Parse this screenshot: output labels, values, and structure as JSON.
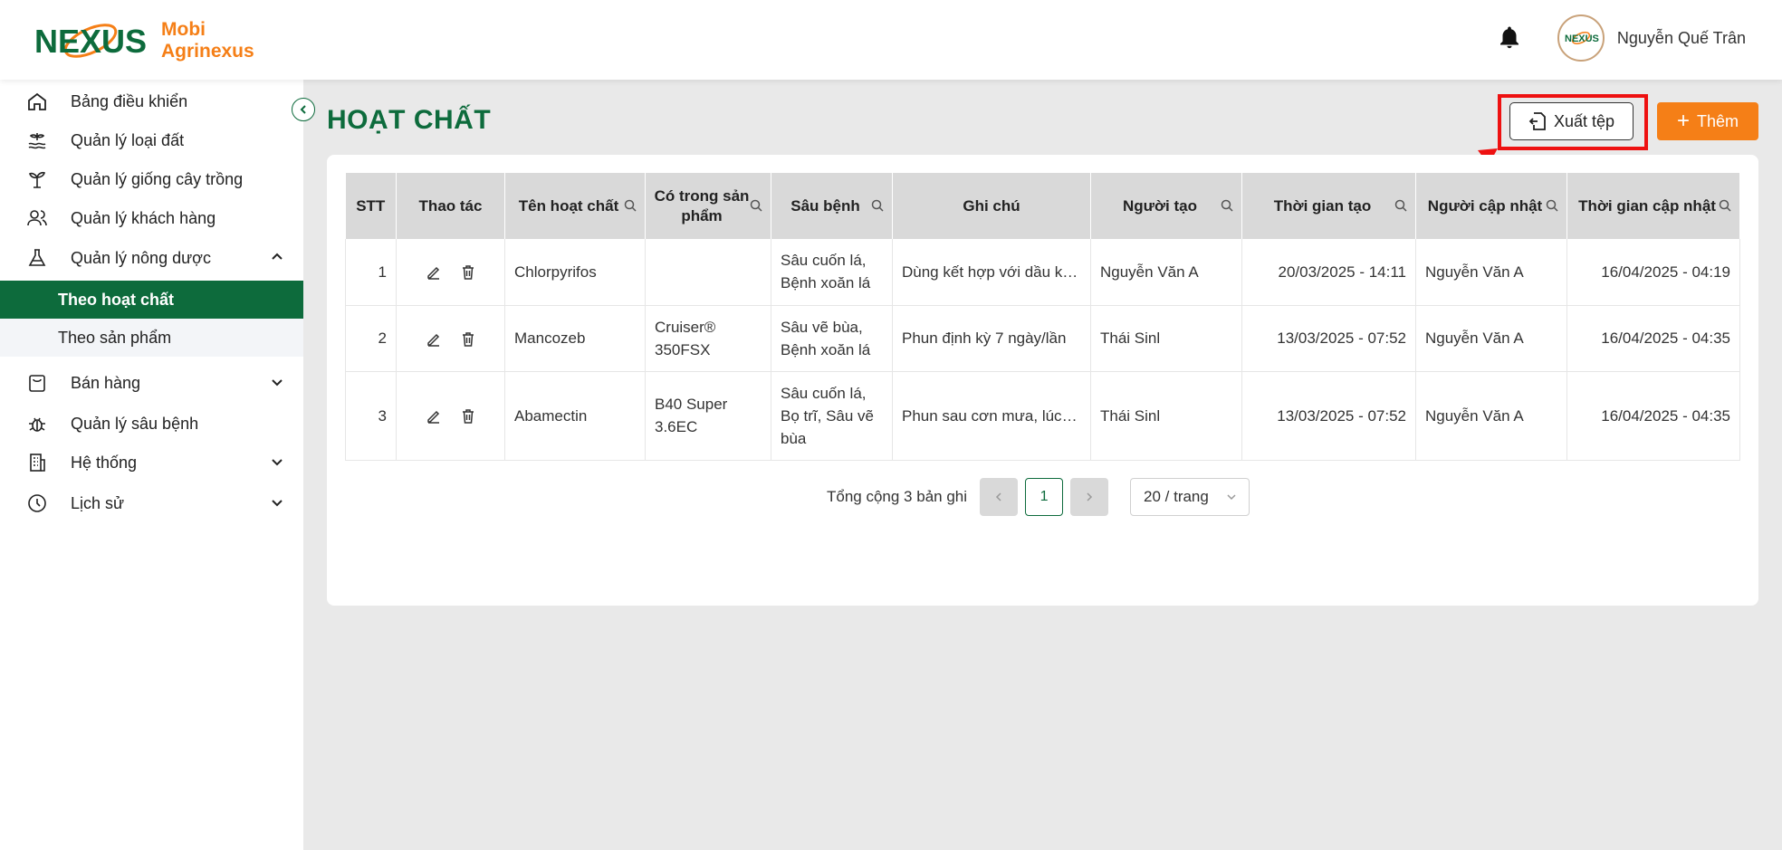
{
  "app": {
    "logo_text_line1": "Mobi",
    "logo_text_line2": "Agrinexus",
    "logo_mark": "NEXUS"
  },
  "header": {
    "user_name": "Nguyễn Quế Trân",
    "avatar_text": "NEXUS"
  },
  "sidebar": {
    "items": [
      {
        "label": "Bảng điều khiển",
        "icon": "home-icon"
      },
      {
        "label": "Quản lý loại đất",
        "icon": "soil-icon"
      },
      {
        "label": "Quản lý giống cây trồng",
        "icon": "plant-icon"
      },
      {
        "label": "Quản lý khách hàng",
        "icon": "users-icon"
      },
      {
        "label": "Quản lý nông dược",
        "icon": "flask-icon"
      },
      {
        "label": "Bán hàng",
        "icon": "bag-icon"
      },
      {
        "label": "Quản lý sâu bệnh",
        "icon": "bug-icon"
      },
      {
        "label": "Hệ thống",
        "icon": "building-icon"
      },
      {
        "label": "Lịch sử",
        "icon": "clock-icon"
      }
    ],
    "sub_items": [
      {
        "label": "Theo hoạt chất"
      },
      {
        "label": "Theo sản phẩm"
      }
    ]
  },
  "page": {
    "title": "HOẠT CHẤT",
    "export_label": "Xuất tệp",
    "add_label": "Thêm"
  },
  "table": {
    "headers": [
      "STT",
      "Thao tác",
      "Tên hoạt chất",
      "Có trong sản phẩm",
      "Sâu bệnh",
      "Ghi chú",
      "Người tạo",
      "Thời gian tạo",
      "Người cập nhật",
      "Thời gian cập nhật"
    ],
    "rows": [
      {
        "stt": "1",
        "name": "Chlorpyrifos",
        "product": "",
        "pest": "Sâu cuốn lá, Bệnh xoăn lá",
        "note": "Dùng kết hợp với dầu khoáng để tăng hiệu quả",
        "creator": "Nguyễn Văn A",
        "created": "20/03/2025 - 14:11",
        "updater": "Nguyễn Văn A",
        "updated": "16/04/2025 - 04:19"
      },
      {
        "stt": "2",
        "name": "Mancozeb",
        "product": "Cruiser® 350FSX",
        "pest": "Sâu vẽ bùa, Bệnh xoăn lá",
        "note": "Phun định kỳ 7 ngày/lần",
        "creator": "Thái Sinl",
        "created": "13/03/2025 - 07:52",
        "updater": "Nguyễn Văn A",
        "updated": "16/04/2025 - 04:35"
      },
      {
        "stt": "3",
        "name": "Abamectin",
        "product": "B40 Super 3.6EC",
        "pest": "Sâu cuốn lá, Bọ trĩ, Sâu vẽ bùa",
        "note": "Phun sau cơn mưa, lúc chiều mát",
        "creator": "Thái Sinl",
        "created": "13/03/2025 - 07:52",
        "updater": "Nguyễn Văn A",
        "updated": "16/04/2025 - 04:35"
      }
    ]
  },
  "pagination": {
    "total_text": "Tổng cộng 3 bản ghi",
    "current_page": "1",
    "page_size": "20 / trang"
  },
  "colors": {
    "primary_green": "#0d6b3c",
    "accent_orange": "#f57f17",
    "highlight_red": "#ee1111"
  }
}
